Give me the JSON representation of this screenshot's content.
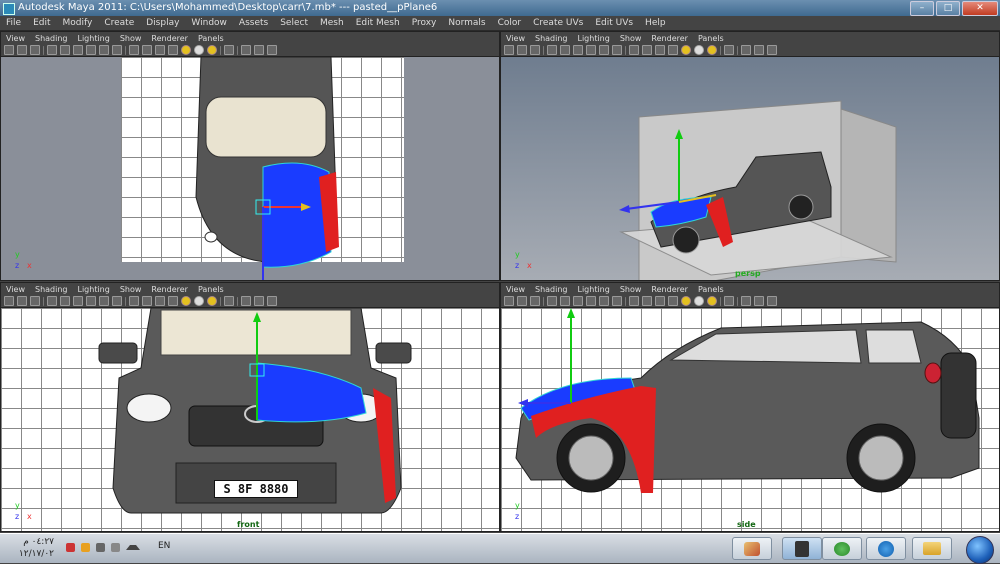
{
  "window": {
    "title": "Autodesk Maya 2011: C:\\Users\\Mohammed\\Desktop\\carr\\7.mb*  ---  pasted__pPlane6",
    "buttons": [
      "–",
      "□",
      "✕"
    ]
  },
  "menubar": [
    "File",
    "Edit",
    "Modify",
    "Create",
    "Display",
    "Window",
    "Assets",
    "Select",
    "Mesh",
    "Edit Mesh",
    "Proxy",
    "Normals",
    "Color",
    "Create UVs",
    "Edit UVs",
    "Help"
  ],
  "panel_menu": [
    "View",
    "Shading",
    "Lighting",
    "Show",
    "Renderer",
    "Panels"
  ],
  "viewports": {
    "top": {
      "label": ""
    },
    "persp": {
      "label": "persp"
    },
    "front": {
      "label": "front",
      "plate": "S 8F 8880"
    },
    "side": {
      "label": "side"
    }
  },
  "axes": {
    "y": "y",
    "x": "x",
    "z": "z"
  },
  "taskbar": {
    "time": "٠٤:٢٧ م",
    "date": "١٢/١٧/٠٢",
    "lang": "EN"
  },
  "colors": {
    "selection": "#1a3cff",
    "fender": "#e02020",
    "wire": "#2fd5d5"
  }
}
